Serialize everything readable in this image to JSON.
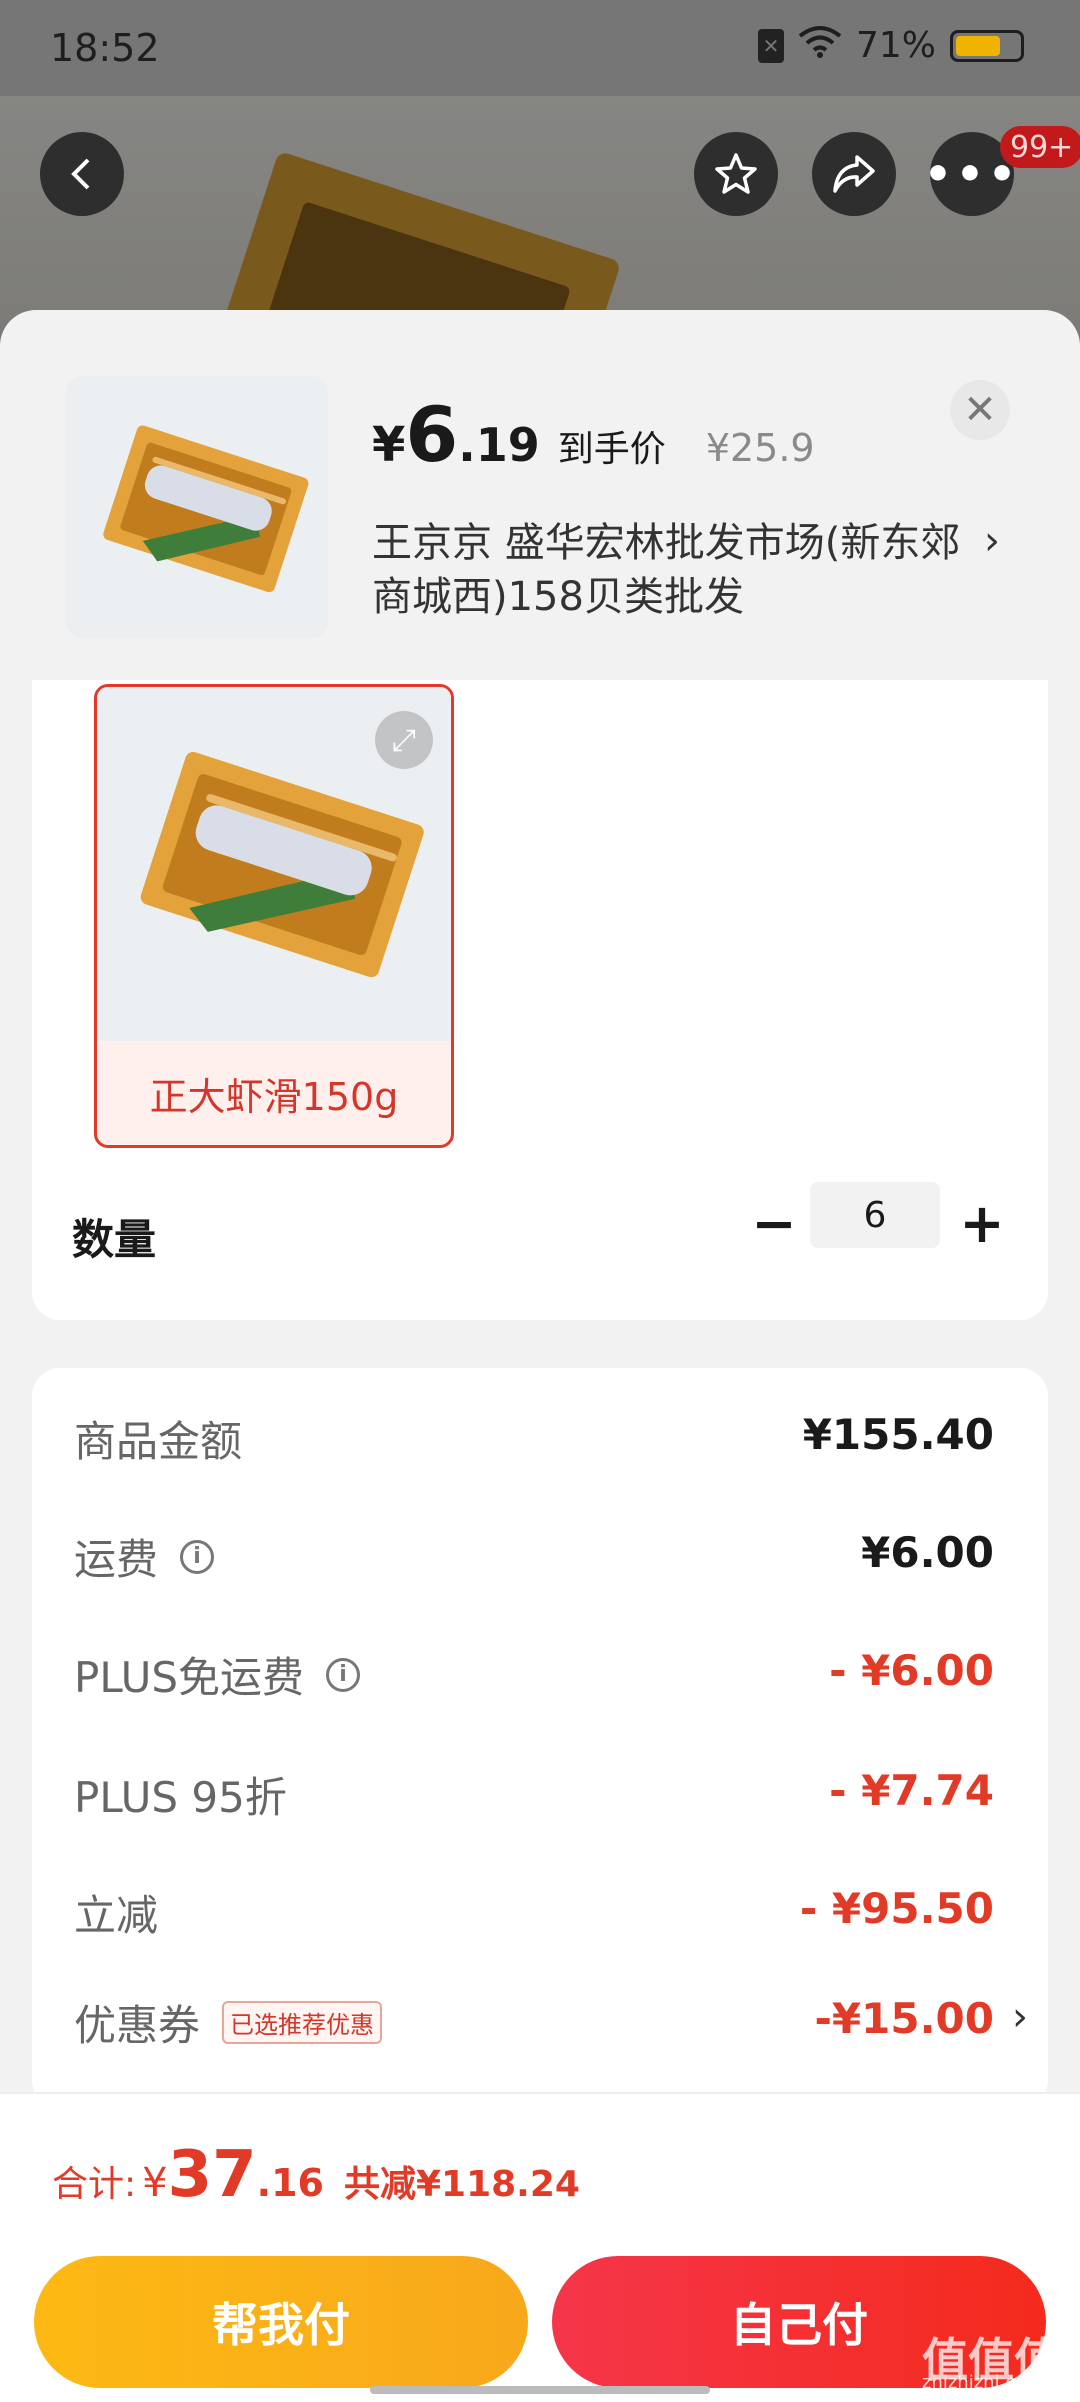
{
  "status_bar": {
    "time": "18:52",
    "battery": "71%",
    "battery_level": 0.71
  },
  "top_nav": {
    "badge": "99+"
  },
  "product": {
    "price_symbol": "¥",
    "price_int": "6",
    "price_dec": ".19",
    "price_tag": "到手价",
    "original_price": "¥25.9",
    "shop": "王京京  盛华宏林批发市场(新东郊商城西)158贝类批发",
    "shop_arrow": "›"
  },
  "variant": {
    "label": "正大虾滑150g"
  },
  "quantity": {
    "label": "数量",
    "minus": "−",
    "value": "6",
    "plus": "+"
  },
  "fees": {
    "goods": {
      "label": "商品金额",
      "value": "¥155.40"
    },
    "shipping": {
      "label": "运费",
      "value": "¥6.00"
    },
    "plus_free_shipping": {
      "label": "PLUS免运费",
      "value": "- ¥6.00"
    },
    "plus_discount": {
      "label": "PLUS 95折",
      "value": "- ¥7.74"
    },
    "instant_discount": {
      "label": "立减",
      "value": "- ¥95.50"
    },
    "coupon": {
      "label": "优惠券",
      "tag": "已选推荐优惠",
      "value": "-¥15.00"
    }
  },
  "bottom": {
    "total_label": "合计:",
    "total_symbol": "¥",
    "total_int": "37",
    "total_dec": ".16",
    "saved": "共减¥118.24",
    "help_pay": "帮我付",
    "self_pay": "自己付"
  },
  "watermark": {
    "main": "值值值",
    "sub": "zhizhizhi.com"
  },
  "colors": {
    "accent_red": "#e13a26",
    "help_button": "#fdb913",
    "self_button": "#f5364a"
  }
}
